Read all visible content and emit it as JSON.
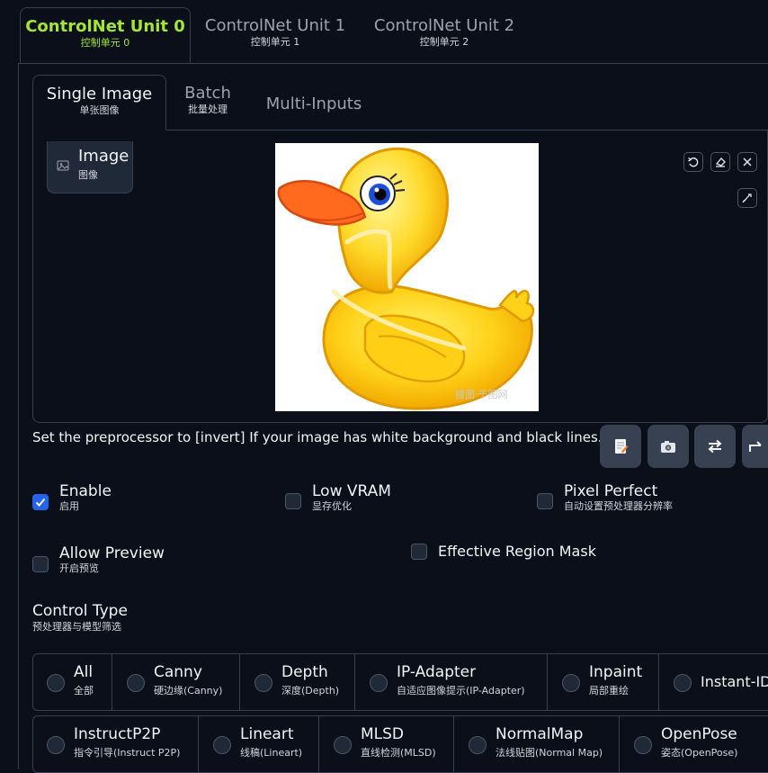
{
  "unit_tabs": [
    {
      "label": "ControlNet Unit 0",
      "sub": "控制单元 0",
      "active": true
    },
    {
      "label": "ControlNet Unit 1",
      "sub": "控制单元 1",
      "active": false
    },
    {
      "label": "ControlNet Unit 2",
      "sub": "控制单元 2",
      "active": false
    }
  ],
  "mode_tabs": [
    {
      "label": "Single Image",
      "sub": "单张图像",
      "active": true
    },
    {
      "label": "Batch",
      "sub": "批量处理",
      "active": false
    },
    {
      "label": "Multi-Inputs",
      "sub": "",
      "active": false
    }
  ],
  "image_panel": {
    "label": "Image",
    "sub": "图像",
    "watermark": "搜图·千图网"
  },
  "hint": "Set the preprocessor to [invert] If your image has white background and black lines.",
  "checkboxes": [
    {
      "label": "Enable",
      "sub": "启用",
      "checked": true
    },
    {
      "label": "Low VRAM",
      "sub": "显存优化",
      "checked": false
    },
    {
      "label": "Pixel Perfect",
      "sub": "自动设置预处理器分辨率",
      "checked": false
    },
    {
      "label": "Allow Preview",
      "sub": "开启预览",
      "checked": false
    },
    {
      "label": "Effective Region Mask",
      "sub": "",
      "checked": false
    }
  ],
  "control_type": {
    "title": "Control Type",
    "sub": "预处理器与模型筛选",
    "row1": [
      {
        "label": "All",
        "sub": "全部"
      },
      {
        "label": "Canny",
        "sub": "硬边缘(Canny)"
      },
      {
        "label": "Depth",
        "sub": "深度(Depth)"
      },
      {
        "label": "IP-Adapter",
        "sub": "自适应图像提示(IP-Adapter)"
      },
      {
        "label": "Inpaint",
        "sub": "局部重绘"
      },
      {
        "label": "Instant-ID",
        "sub": ""
      }
    ],
    "row2": [
      {
        "label": "InstructP2P",
        "sub": "指令引导(Instruct P2P)"
      },
      {
        "label": "Lineart",
        "sub": "线稿(Lineart)"
      },
      {
        "label": "MLSD",
        "sub": "直线检测(MLSD)"
      },
      {
        "label": "NormalMap",
        "sub": "法线贴图(Normal Map)"
      },
      {
        "label": "OpenPose",
        "sub": "姿态(OpenPose)"
      }
    ]
  },
  "colors": {
    "background": "#0b0f19",
    "accent_green": "#a3e635",
    "check_blue": "#2563eb",
    "border": "#374151"
  }
}
